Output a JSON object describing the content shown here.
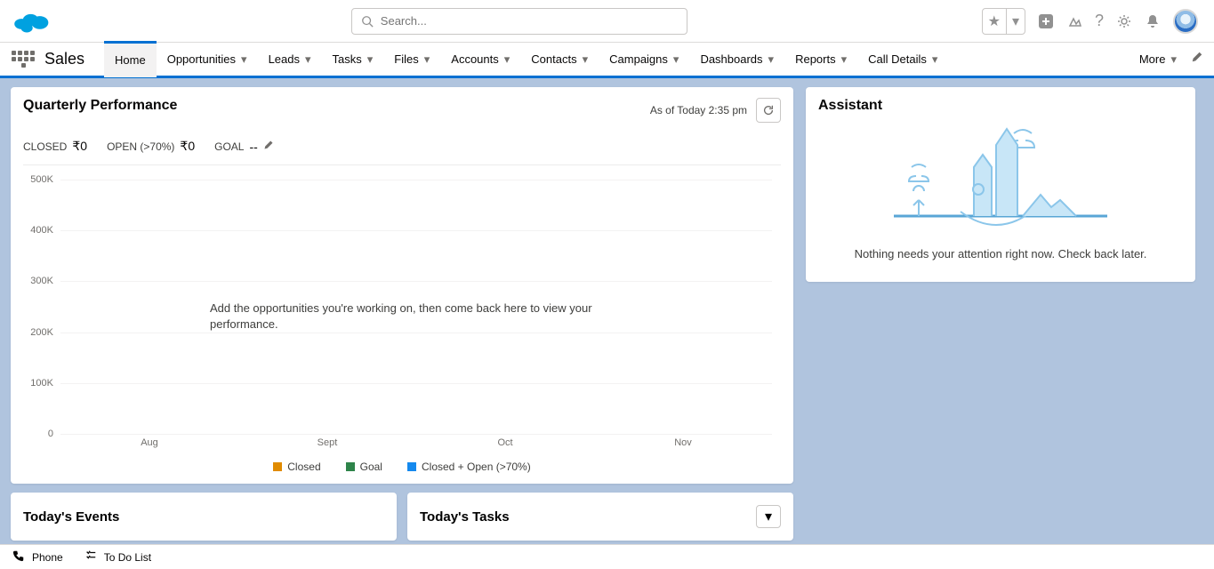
{
  "app_name": "Sales",
  "search": {
    "placeholder": "Search..."
  },
  "nav_tabs": [
    "Home",
    "Opportunities",
    "Leads",
    "Tasks",
    "Files",
    "Accounts",
    "Contacts",
    "Campaigns",
    "Dashboards",
    "Reports",
    "Call Details"
  ],
  "nav_more": "More",
  "perf": {
    "title": "Quarterly Performance",
    "asof": "As of Today 2:35 pm",
    "closed_label": "CLOSED",
    "closed_value": "₹0",
    "open_label": "OPEN (>70%)",
    "open_value": "₹0",
    "goal_label": "GOAL",
    "goal_value": "--",
    "empty_msg": "Add the opportunities you're working on, then come back here to view your performance."
  },
  "chart_data": {
    "type": "bar",
    "categories": [
      "Aug",
      "Sept",
      "Oct",
      "Nov"
    ],
    "y_ticks": [
      "0",
      "100K",
      "200K",
      "300K",
      "400K",
      "500K"
    ],
    "ylim": [
      0,
      500000
    ],
    "series": [
      {
        "name": "Closed",
        "color": "#e08b00",
        "values": [
          0,
          0,
          0,
          0
        ]
      },
      {
        "name": "Goal",
        "color": "#2e844a",
        "values": [
          0,
          0,
          0,
          0
        ]
      },
      {
        "name": "Closed + Open (>70%)",
        "color": "#1589ee",
        "values": [
          0,
          0,
          0,
          0
        ]
      }
    ]
  },
  "events_card": "Today's Events",
  "tasks_card": "Today's Tasks",
  "assistant": {
    "title": "Assistant",
    "msg": "Nothing needs your attention right now. Check back later."
  },
  "footer": {
    "phone": "Phone",
    "todo": "To Do List"
  }
}
